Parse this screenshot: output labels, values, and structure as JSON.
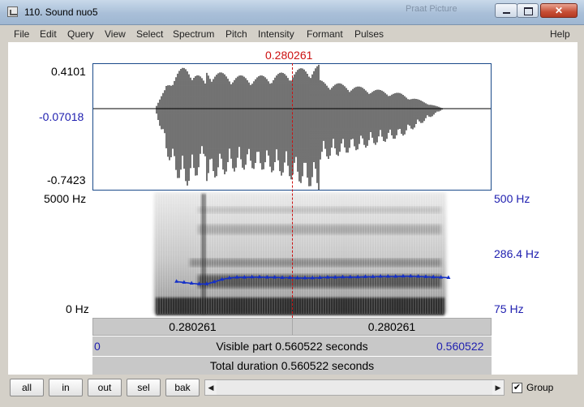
{
  "window": {
    "title": "110. Sound nuo5",
    "background_title": "Praat Picture"
  },
  "menubar": {
    "items": [
      "File",
      "Edit",
      "Query",
      "View",
      "Select",
      "Spectrum",
      "Pitch",
      "Intensity",
      "Formant",
      "Pulses"
    ],
    "help": "Help"
  },
  "cursor": {
    "time_label": "0.280261",
    "time": 0.280261
  },
  "waveform": {
    "max_label": "0.4101",
    "cursor_value_label": "-0.07018",
    "min_label": "-0.7423"
  },
  "spectrogram": {
    "top_freq_label": "5000 Hz",
    "bottom_freq_label": "0 Hz"
  },
  "pitch": {
    "top_label": "500 Hz",
    "mid_label": "286.4 Hz",
    "bottom_label": "75 Hz",
    "min_hz": 75,
    "max_hz": 500,
    "start_time": 0.118,
    "end_time": 0.5,
    "values_hz": [
      196,
      193,
      190,
      188,
      188,
      195,
      203,
      208,
      210,
      210,
      211,
      211,
      210,
      210,
      209,
      209,
      208,
      208,
      208,
      209,
      210,
      210,
      211,
      211,
      211,
      212,
      212,
      213,
      213,
      213,
      214,
      214,
      213,
      212,
      211,
      210,
      209
    ]
  },
  "time_bar": {
    "left_segment": "0.280261",
    "right_segment": "0.280261"
  },
  "visible_bar": {
    "start": "0",
    "label": "Visible part 0.560522 seconds",
    "end": "0.560522"
  },
  "total_bar": {
    "label": "Total duration 0.560522 seconds"
  },
  "controls": {
    "buttons": [
      "all",
      "in",
      "out",
      "sel",
      "bak"
    ],
    "group_label": "Group",
    "group_checked": true
  },
  "colors": {
    "cursor": "#cc1010",
    "pitch": "#1530c8",
    "axis_blue": "#2020b0"
  }
}
